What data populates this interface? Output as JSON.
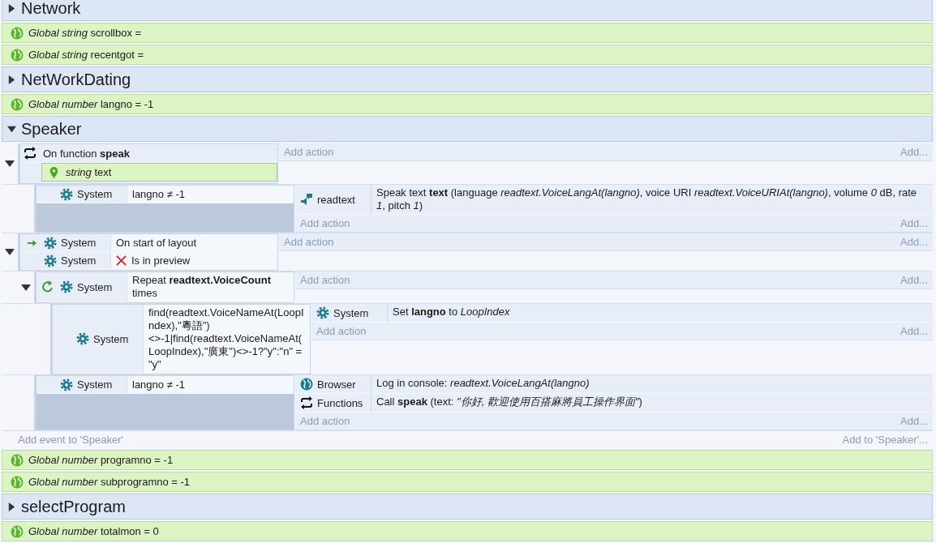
{
  "sheet": [
    {
      "kind": "group",
      "title": "Network",
      "expanded": false
    },
    {
      "kind": "variable",
      "text": "*Global string* scrollbox ="
    },
    {
      "kind": "variable",
      "text": "*Global string* recentgot ="
    },
    {
      "kind": "group",
      "title": "NetWorkDating",
      "expanded": false
    },
    {
      "kind": "variable",
      "text": "*Global number* langno = -1"
    },
    {
      "kind": "group",
      "title": "Speaker",
      "expanded": true,
      "add_event": "Add event to 'Speaker'",
      "add_more": "Add to 'Speaker'...",
      "events": [
        {
          "expanded": true,
          "loop": false,
          "conditions": [
            {
              "kind": "function",
              "text": "On function **speak**",
              "trigger": false,
              "inverted": false
            }
          ],
          "params": [
            {
              "text": "*string* text"
            }
          ],
          "add_action": "Add action",
          "add_more": "Add...",
          "children": [
            {
              "loop": false,
              "conditions": [
                {
                  "kind": "system",
                  "object": "System",
                  "text": "langno ≠ -1",
                  "trigger": false,
                  "inverted": false
                }
              ],
              "actions": [
                {
                  "kind": "speech",
                  "object": "readtext",
                  "text": "Speak text **text** (language *readtext.VoiceLangAt(langno)*, voice URI *readtext.VoiceURIAt(langno)*, volume *0* dB, rate *1*, pitch *1*)"
                }
              ],
              "add_action": "Add action",
              "add_more": "Add..."
            }
          ]
        },
        {
          "expanded": true,
          "loop": false,
          "conditions": [
            {
              "kind": "system",
              "object": "System",
              "text": "On start of layout",
              "trigger": true,
              "inverted": false
            },
            {
              "kind": "system",
              "object": "System",
              "text": "Is in preview",
              "trigger": false,
              "inverted": true
            }
          ],
          "add_action": "Add action",
          "add_more": "Add...",
          "children": [
            {
              "expanded": true,
              "loop": true,
              "conditions": [
                {
                  "kind": "system",
                  "object": "System",
                  "text": "Repeat **readtext.VoiceCount** times",
                  "trigger": false,
                  "inverted": false
                }
              ],
              "add_action": "Add action",
              "add_more": "Add...",
              "children": [
                {
                  "loop": false,
                  "conditions": [
                    {
                      "kind": "system",
                      "object": "System",
                      "text": "find(readtext.VoiceNameAt(LoopIndex),\"粵語\")<>-1|find(readtext.VoiceNameAt(LoopIndex),\"廣東\")<>-1?\"y\":\"n\" = \"y\"",
                      "trigger": false,
                      "inverted": false
                    }
                  ],
                  "actions": [
                    {
                      "kind": "system",
                      "object": "System",
                      "text": "Set **langno** to *LoopIndex*"
                    }
                  ],
                  "add_action": "Add action",
                  "add_more": "Add..."
                }
              ]
            },
            {
              "loop": false,
              "conditions": [
                {
                  "kind": "system",
                  "object": "System",
                  "text": "langno ≠ -1",
                  "trigger": false,
                  "inverted": false
                }
              ],
              "actions": [
                {
                  "kind": "browser",
                  "object": "Browser",
                  "text": "Log in console: *readtext.VoiceLangAt(langno)*"
                },
                {
                  "kind": "function",
                  "object": "Functions",
                  "text": "Call **speak** (text: *\"你好, 歡迎使用百搭麻將員工操作界面\"*)"
                }
              ],
              "add_action": "Add action",
              "add_more": "Add..."
            }
          ]
        }
      ]
    },
    {
      "kind": "variable",
      "text": "*Global number* programno = -1"
    },
    {
      "kind": "variable",
      "text": "*Global number* subprogramno = -1"
    },
    {
      "kind": "group",
      "title": "selectProgram",
      "expanded": false
    },
    {
      "kind": "variable",
      "text": "*Global number* totalmon = 0"
    }
  ]
}
